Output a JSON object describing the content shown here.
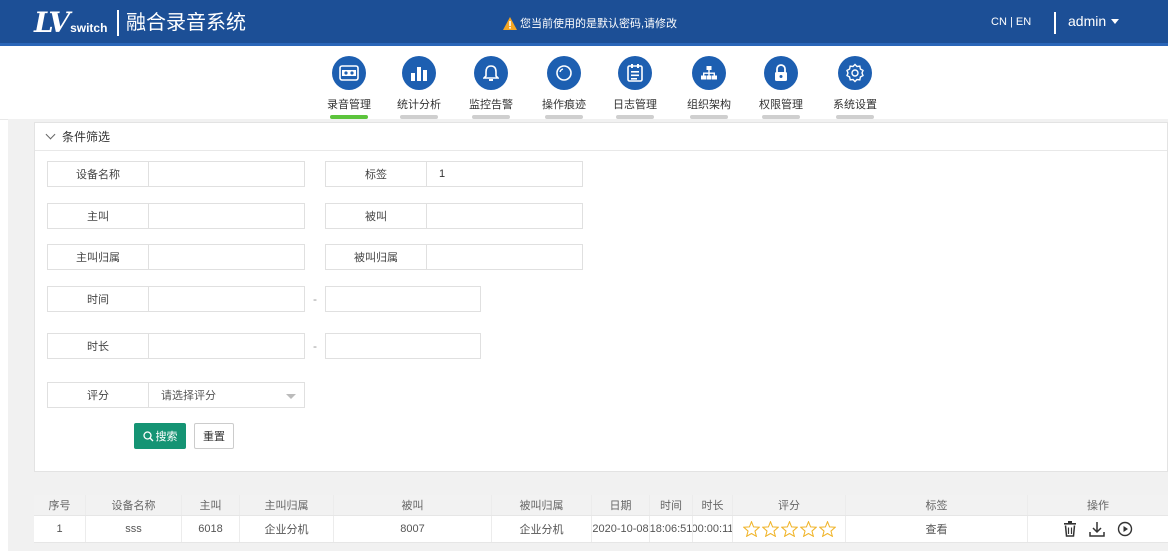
{
  "header": {
    "logo_main": "LV",
    "logo_sub": "switch",
    "app_title": "融合录音系统",
    "warning": "您当前使用的是默认密码,请修改",
    "lang": "CN | EN",
    "user": "admin"
  },
  "nav": [
    {
      "label": "录音管理",
      "icon": "recorder-icon",
      "active": true
    },
    {
      "label": "统计分析",
      "icon": "bar-chart-icon",
      "active": false
    },
    {
      "label": "监控告警",
      "icon": "bell-icon",
      "active": false
    },
    {
      "label": "操作痕迹",
      "icon": "search-icon",
      "active": false
    },
    {
      "label": "日志管理",
      "icon": "document-icon",
      "active": false
    },
    {
      "label": "组织架构",
      "icon": "org-chart-icon",
      "active": false
    },
    {
      "label": "权限管理",
      "icon": "lock-icon",
      "active": false
    },
    {
      "label": "系统设置",
      "icon": "gear-icon",
      "active": false
    }
  ],
  "filter": {
    "title": "条件筛选",
    "device_name_label": "设备名称",
    "device_name_value": "",
    "tag_label": "标签",
    "tag_value": "1",
    "caller_label": "主叫",
    "caller_value": "",
    "callee_label": "被叫",
    "callee_value": "",
    "caller_home_label": "主叫归属",
    "caller_home_value": "",
    "callee_home_label": "被叫归属",
    "callee_home_value": "",
    "time_label": "时间",
    "time_sep": "-",
    "duration_label": "时长",
    "duration_sep": "-",
    "rating_label": "评分",
    "rating_placeholder": "请选择评分",
    "search_label": "搜索",
    "reset_label": "重置"
  },
  "table": {
    "columns": [
      "序号",
      "设备名称",
      "主叫",
      "主叫归属",
      "被叫",
      "被叫归属",
      "日期",
      "时间",
      "时长",
      "评分",
      "标签",
      "操作"
    ],
    "rows": [
      {
        "index": "1",
        "device": "sss",
        "caller": "6018",
        "caller_home": "企业分机",
        "callee": "8007",
        "callee_home": "企业分机",
        "date": "2020-10-08",
        "time": "18:06:51",
        "duration": "00:00:11",
        "rating": 0,
        "tag": "查看"
      }
    ]
  },
  "colors": {
    "header_bg": "#1c4f96",
    "nav_icon": "#1d5fb1",
    "active_bar": "#5cc43c",
    "search_btn": "#159474",
    "star": "#f0b429",
    "warning": "#f5a623"
  }
}
